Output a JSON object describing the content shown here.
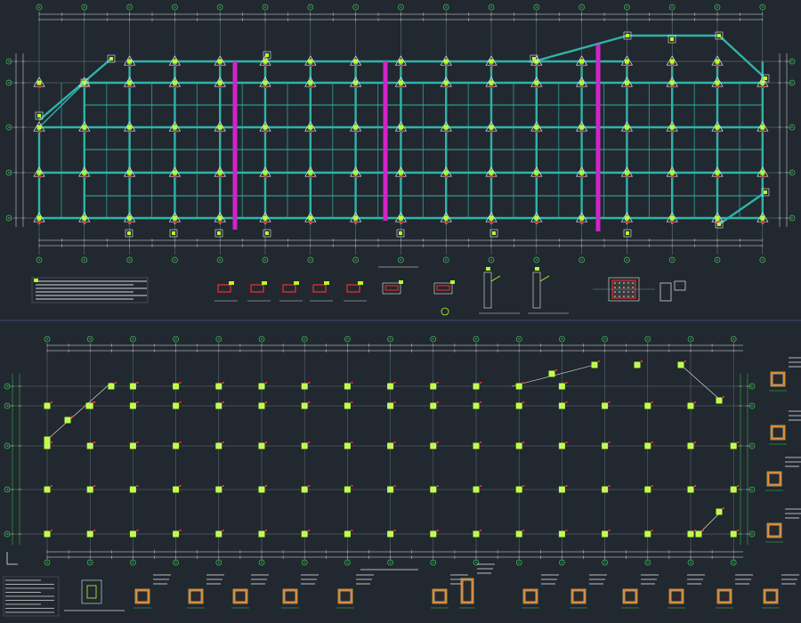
{
  "colors": {
    "background": "#212830",
    "beam": "#2fb3a8",
    "grid_line": "#9aa3ad",
    "axis_line": "#2fd24a",
    "column": "#b7ff2c",
    "column_outline": "#ffffff",
    "shear_wall": "#d024c8",
    "rebar": "#ff2a2a",
    "detail_fill": "#c86a1a",
    "separator": "#4a5a8a"
  },
  "top_plan": {
    "column_axis_count": 17,
    "row_axis_count": 5,
    "shear_wall_count": 3,
    "caption": "",
    "notes_caption": ""
  },
  "bottom_plan": {
    "column_axis_count": 17,
    "row_axis_count": 5,
    "caption": ""
  },
  "icons": {
    "axis_bubble": "axis-bubble-icon",
    "column_section": "column-section-icon",
    "ucs": "ucs-icon"
  }
}
